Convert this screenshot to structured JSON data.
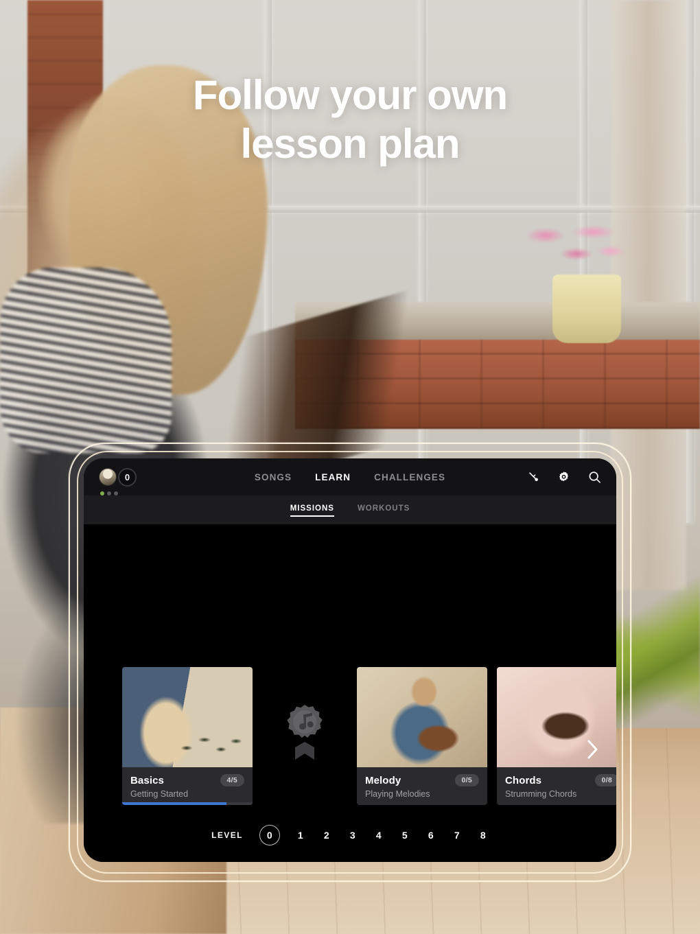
{
  "headline": {
    "line1": "Follow your own",
    "line2": "lesson plan"
  },
  "app": {
    "topbar": {
      "coin_count": "0",
      "nav": [
        {
          "label": "SONGS",
          "active": false
        },
        {
          "label": "LEARN",
          "active": true
        },
        {
          "label": "CHALLENGES",
          "active": false
        }
      ],
      "icons": [
        {
          "name": "tuner-icon"
        },
        {
          "name": "gear-icon"
        },
        {
          "name": "search-icon"
        }
      ]
    },
    "sub_tabs": [
      {
        "label": "MISSIONS",
        "active": true
      },
      {
        "label": "WORKOUTS",
        "active": false
      }
    ],
    "missions": [
      {
        "title": "Basics",
        "subtitle": "Getting Started",
        "badge": "4/5",
        "progress_percent": 80
      },
      {
        "title": "Melody",
        "subtitle": "Playing Melodies",
        "badge": "0/5",
        "progress_percent": 0
      },
      {
        "title": "Chords",
        "subtitle": "Strumming Chords",
        "badge": "0/8",
        "progress_percent": 0
      }
    ],
    "medal": {
      "name": "music-badge-medal",
      "icon": "music-note"
    },
    "carousel_next_icon": "chevron-right-icon",
    "level_selector": {
      "label": "LEVEL",
      "levels": [
        "0",
        "1",
        "2",
        "3",
        "4",
        "5",
        "6",
        "7",
        "8"
      ],
      "selected": "0"
    }
  },
  "colors": {
    "accent_progress": "#3e76d3",
    "screen_bg": "#000000",
    "topbar_bg": "#131315",
    "subtab_bg": "#1c1c1f",
    "card_bg": "#2b2b2e",
    "frame_outline": "#fff6e2"
  }
}
